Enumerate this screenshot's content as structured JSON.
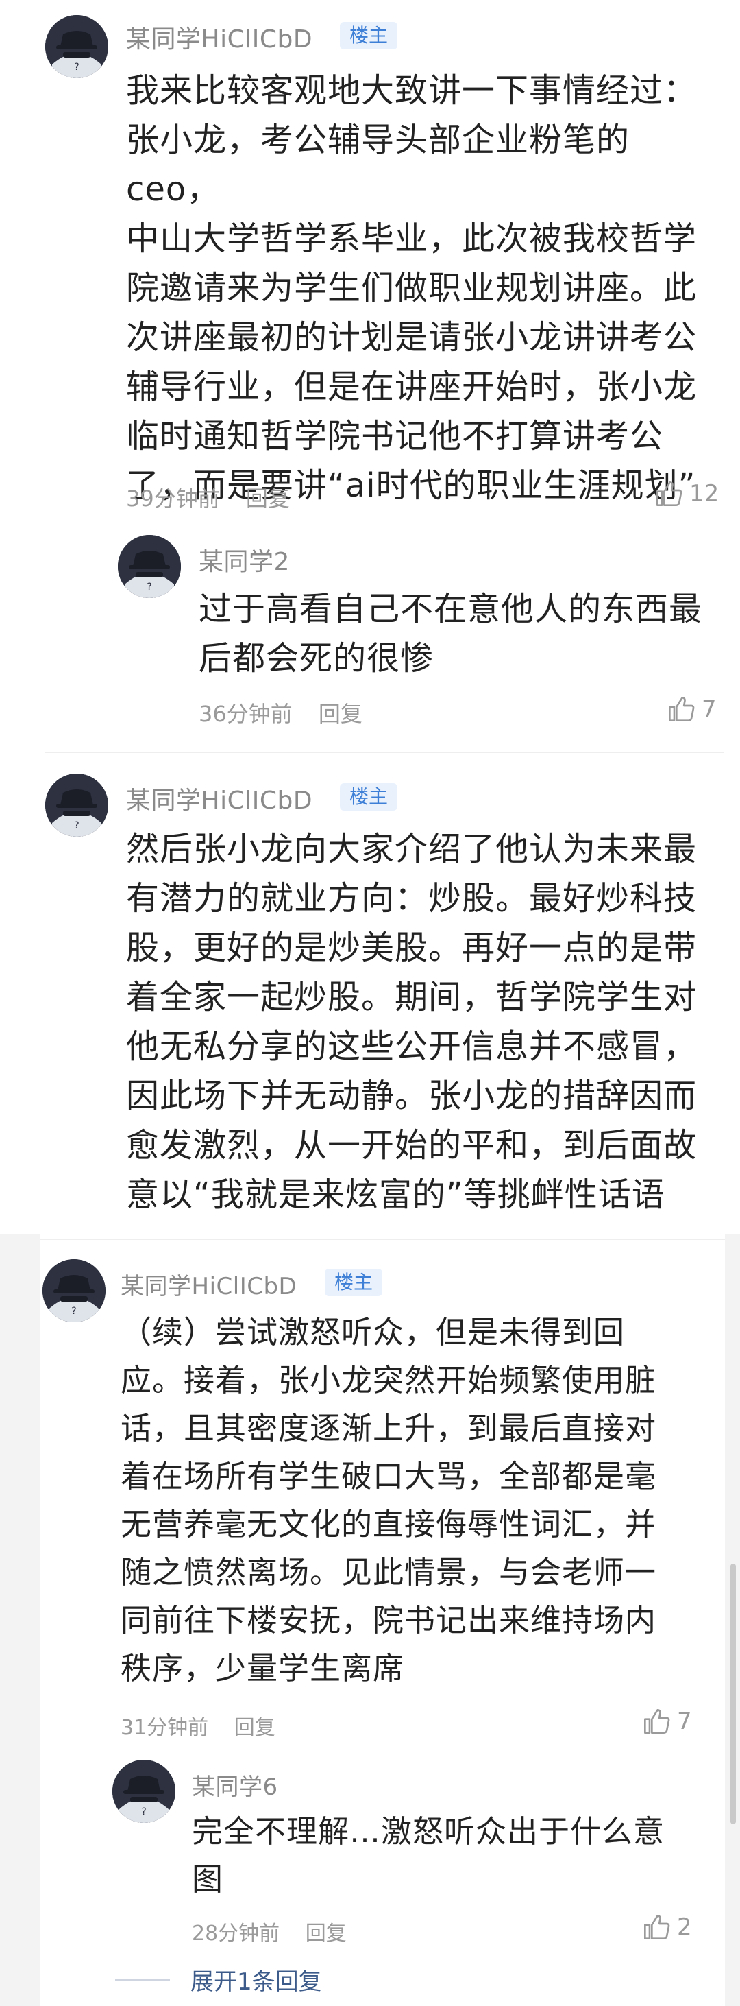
{
  "comments": [
    {
      "username": "某同学HiClICbD",
      "badge": "楼主",
      "lines": [
        "我来比较客观地大致讲一下事情经过：",
        "张小龙，考公辅导头部企业粉笔的ceo，",
        "中山大学哲学系毕业，此次被我校哲学",
        "院邀请来为学生们做职业规划讲座。此",
        "次讲座最初的计划是请张小龙讲讲考公",
        "辅导行业，但是在讲座开始时，张小龙",
        "临时通知哲学院书记他不打算讲考公",
        "了，而是要讲“ai时代的职业生涯规划”"
      ],
      "time": "39分钟前",
      "reply": "回复",
      "likes": "12",
      "replies": [
        {
          "username": "某同学2",
          "lines": [
            "过于高看自己不在意他人的东西最",
            "后都会死的很惨"
          ],
          "time": "36分钟前",
          "reply": "回复",
          "likes": "7"
        }
      ]
    },
    {
      "username": "某同学HiClICbD",
      "badge": "楼主",
      "lines": [
        "然后张小龙向大家介绍了他认为未来最",
        "有潜力的就业方向：炒股。最好炒科技",
        "股，更好的是炒美股。再好一点的是带",
        "着全家一起炒股。期间，哲学院学生对",
        "他无私分享的这些公开信息并不感冒，",
        "因此场下并无动静。张小龙的措辞因而",
        "愈发激烈，从一开始的平和，到后面故",
        "意以“我就是来炫富的”等挑衅性话语"
      ]
    },
    {
      "username": "某同学HiClICbD",
      "badge": "楼主",
      "lines": [
        "（续）尝试激怒听众，但是未得到回",
        "应。接着，张小龙突然开始频繁使用脏",
        "话，且其密度逐渐上升，到最后直接对",
        "着在场所有学生破口大骂，全部都是毫",
        "无营养毫无文化的直接侮辱性词汇，并",
        "随之愤然离场。见此情景，与会老师一",
        "同前往下楼安抚，院书记出来维持场内",
        "秩序，少量学生离席"
      ],
      "time": "31分钟前",
      "reply": "回复",
      "likes": "7",
      "replies": [
        {
          "username": "某同学6",
          "lines": [
            "完全不理解…激怒听众出于什么意",
            "图"
          ],
          "time": "28分钟前",
          "reply": "回复",
          "likes": "2"
        }
      ],
      "expand": "展开1条回复"
    }
  ],
  "icons": {
    "like": "thumbs-up-icon",
    "avatar": "anonymous-hat-avatar-icon"
  },
  "colors": {
    "badge_text": "#3d7fd6",
    "badge_bg": "#e9f1fd",
    "link": "#3d5b8a"
  }
}
